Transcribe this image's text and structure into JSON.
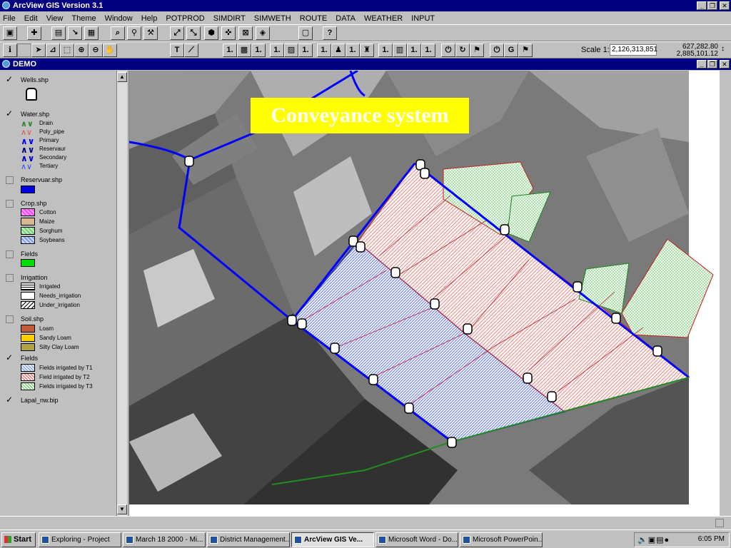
{
  "app": {
    "title": "ArcView GIS Version 3.1"
  },
  "menu": [
    "File",
    "Edit",
    "View",
    "Theme",
    "Window",
    "Help",
    "POTPROD",
    "SIMDIRT",
    "SIMWETH",
    "ROUTE",
    "DATA",
    "WEATHER",
    "INPUT"
  ],
  "toolbar2": {
    "scale_label": "Scale 1:",
    "scale_value": "2,126,313,851",
    "coord_x": "627,282.80",
    "coord_y": "2,885,101.12",
    "num_label": "1.",
    "g_label": "G"
  },
  "view": {
    "title": "DEMO"
  },
  "toc": {
    "themes": [
      {
        "name": "Wells.shp",
        "checked": true
      },
      {
        "name": "Water.shp",
        "checked": true
      },
      {
        "name": "Reservuar.shp",
        "checked": false
      },
      {
        "name": "Crop.shp",
        "checked": false
      },
      {
        "name": "Fields",
        "checked": false
      },
      {
        "name": "Irrigattion",
        "checked": false
      },
      {
        "name": "Soil.shp",
        "checked": false
      },
      {
        "name": "Fields",
        "checked": true
      },
      {
        "name": "Lapal_nw.bip",
        "checked": true
      }
    ],
    "water_legend": [
      "Drain",
      "Poly_pipe",
      "Primary",
      "Reservaur",
      "Secondary",
      "Tertiary"
    ],
    "crop_legend": [
      "Cotton",
      "Maize",
      "Sorghum",
      "Soybeans"
    ],
    "irrigation_legend": [
      "Irrigated",
      "Needs_irrigation",
      "Under_irrigation"
    ],
    "soil_legend": [
      "Loam",
      "Sandy Loam",
      "Silty Clay Loam"
    ],
    "fields_legend": [
      "Fields irrigated by T1",
      "Field irrigated by T2",
      "Fields irrigated by T3"
    ]
  },
  "map": {
    "title": "Conveyance system"
  },
  "colors": {
    "titlebar": "#000080",
    "primary_canal": "#0000ff",
    "drain": "#228b22",
    "t1": "#3050c0",
    "t2": "#d02020",
    "t3": "#30a030",
    "map_title_bg": "#ffff00"
  },
  "taskbar": {
    "start": "Start",
    "tasks": [
      "Exploring - Project",
      "March 18 2000 - Mi...",
      "District Management...",
      "ArcView GIS Ve...",
      "Microsoft Word - Do...",
      "Microsoft PowerPoin..."
    ],
    "clock": "6:05 PM"
  }
}
